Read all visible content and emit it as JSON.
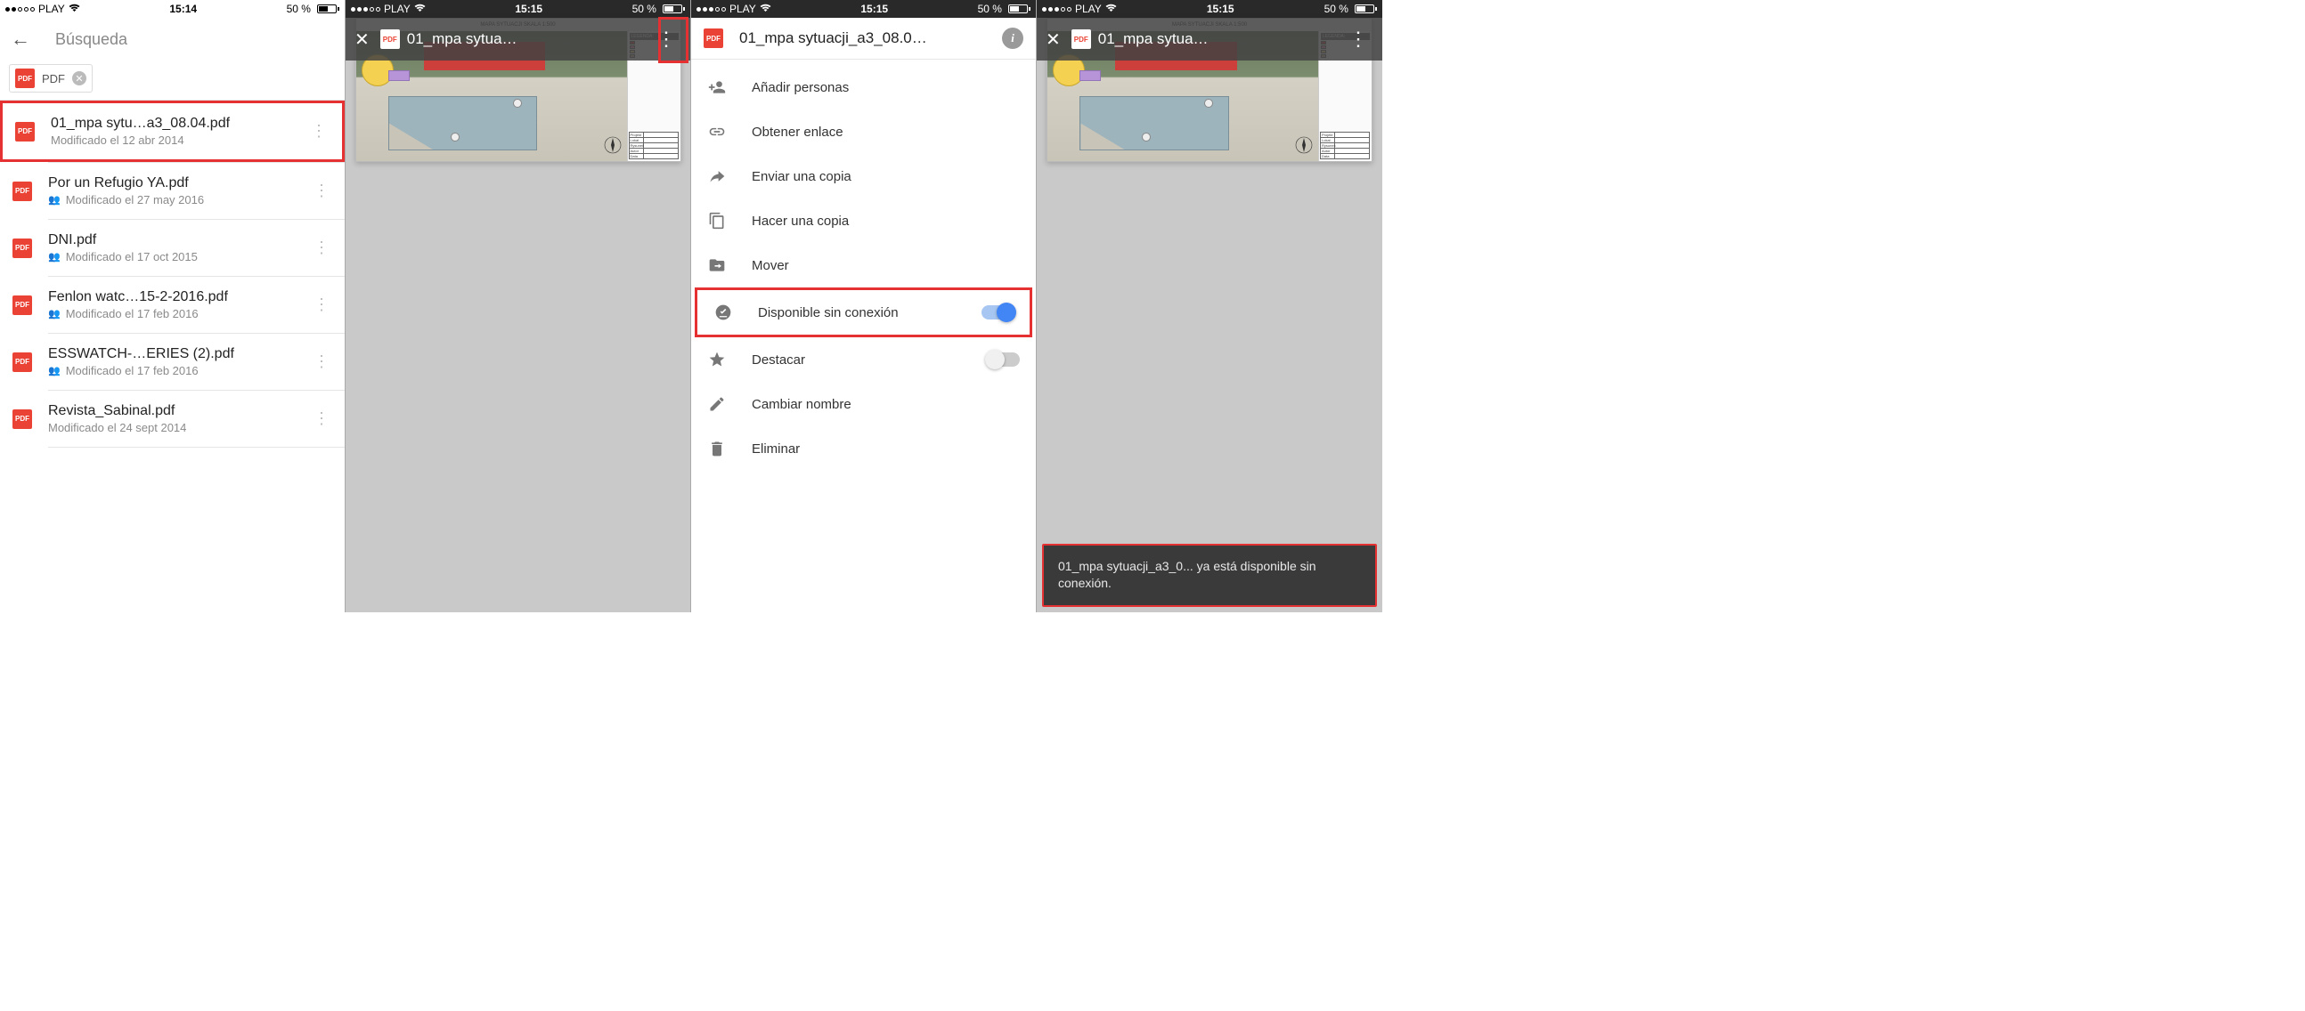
{
  "status": {
    "carrier": "PLAY",
    "battery_pct": "50 %",
    "time_s1": "15:14",
    "time_s2": "15:15",
    "time_s3": "15:15",
    "time_s4": "15:15"
  },
  "screen1": {
    "nav_title": "Búsqueda",
    "chip_label": "PDF",
    "files": [
      {
        "name": "01_mpa sytu…a3_08.04.pdf",
        "sub": "Modificado el 12 abr 2014",
        "shared": false
      },
      {
        "name": "Por un Refugio YA.pdf",
        "sub": "Modificado el 27 may 2016",
        "shared": true
      },
      {
        "name": "DNI.pdf",
        "sub": "Modificado el 17 oct 2015",
        "shared": true
      },
      {
        "name": "Fenlon watc…15-2-2016.pdf",
        "sub": "Modificado el 17 feb 2016",
        "shared": true
      },
      {
        "name": "ESSWATCH-…ERIES (2).pdf",
        "sub": "Modificado el 17 feb 2016",
        "shared": true
      },
      {
        "name": "Revista_Sabinal.pdf",
        "sub": "Modificado el 24 sept 2014",
        "shared": false
      }
    ]
  },
  "screen2": {
    "title": "01_mpa sytua…",
    "map_header": "MAPA SYTUACJI SKALA 1:500",
    "legend_title": "LEGENDA:"
  },
  "screen3": {
    "title": "01_mpa sytuacji_a3_08.0…",
    "items": {
      "add_people": "Añadir personas",
      "get_link": "Obtener enlace",
      "send_copy": "Enviar una copia",
      "make_copy": "Hacer una copia",
      "move": "Mover",
      "offline": "Disponible sin conexión",
      "star": "Destacar",
      "rename": "Cambiar nombre",
      "delete": "Eliminar"
    }
  },
  "screen4": {
    "title": "01_mpa sytua…",
    "toast": "01_mpa sytuacji_a3_0... ya está disponible sin conexión."
  }
}
